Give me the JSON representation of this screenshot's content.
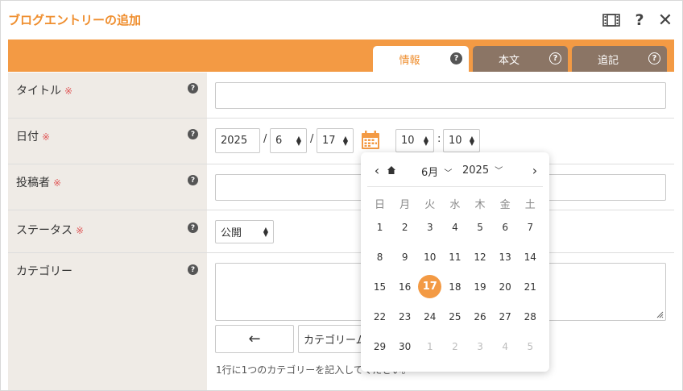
{
  "dialog": {
    "title": "ブログエントリーの追加",
    "icons": {
      "film": "film-icon",
      "help": "?",
      "close": "✕"
    }
  },
  "tabs": [
    {
      "label": "情報",
      "help": "?",
      "active": true
    },
    {
      "label": "本文",
      "help": "?",
      "active": false
    },
    {
      "label": "追記",
      "help": "?",
      "active": false
    }
  ],
  "form": {
    "title": {
      "label": "タイトル",
      "required": "※",
      "help": "?",
      "value": ""
    },
    "date": {
      "label": "日付",
      "required": "※",
      "help": "?",
      "year": "2025",
      "sep1": "/",
      "month": "6",
      "sep2": "/",
      "day": "17",
      "hour": "10",
      "time_sep": ":",
      "minute": "10"
    },
    "author": {
      "label": "投稿者",
      "required": "※",
      "help": "?",
      "value": ""
    },
    "status": {
      "label": "ステータス",
      "required": "※",
      "help": "?",
      "value": "公開"
    },
    "category": {
      "label": "カテゴリー",
      "help": "?",
      "back_button": "←",
      "input_value": "カテゴリーム",
      "hint": "1行に1つのカテゴリーを記入してください。"
    }
  },
  "calendar": {
    "month": "6月",
    "year": "2025",
    "weekdays": [
      "日",
      "月",
      "火",
      "水",
      "木",
      "金",
      "土"
    ],
    "weeks": [
      [
        "1",
        "2",
        "3",
        "4",
        "5",
        "6",
        "7"
      ],
      [
        "8",
        "9",
        "10",
        "11",
        "12",
        "13",
        "14"
      ],
      [
        "15",
        "16",
        "17",
        "18",
        "19",
        "20",
        "21"
      ],
      [
        "22",
        "23",
        "24",
        "25",
        "26",
        "27",
        "28"
      ],
      [
        "29",
        "30",
        "1",
        "2",
        "3",
        "4",
        "5"
      ]
    ],
    "selected_day": "17",
    "colors": {
      "accent": "#f39a44",
      "muted": "#bdbdbd"
    }
  },
  "colors": {
    "accent": "#f39a44",
    "title": "#ef8e2e",
    "tab_inactive": "#8b7565",
    "label_bg": "#efebe6",
    "required": "#e05a5a"
  }
}
